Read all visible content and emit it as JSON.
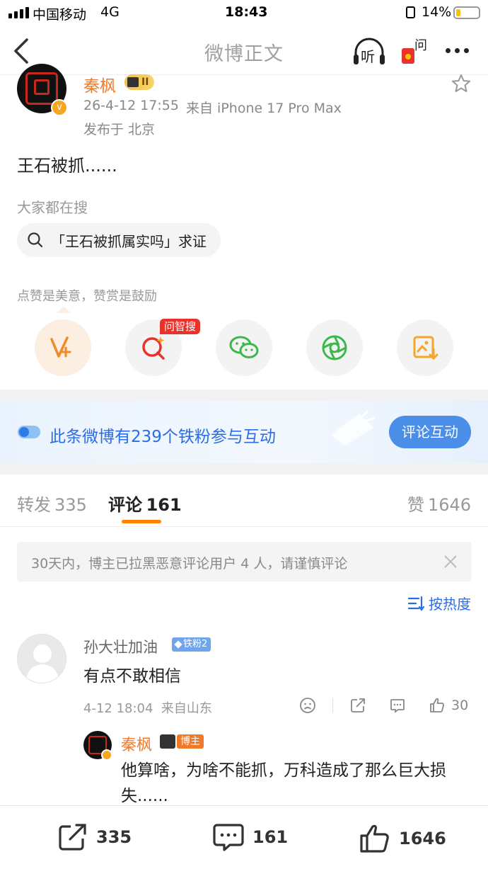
{
  "status": {
    "carrier": "中国移动",
    "network": "4G",
    "time": "18:43",
    "battery": "14%"
  },
  "nav": {
    "title": "微博正文",
    "listen_label": "听",
    "ask_label": "问"
  },
  "post": {
    "author": "秦枫",
    "badge_level": "II",
    "timestamp": "26-4-12 17:55",
    "source": "来自 iPhone 17 Pro Max",
    "location": "发布于 北京",
    "content": "王石被抓......"
  },
  "search": {
    "section_label": "大家都在搜",
    "pill_text": "「王石被抓属实吗」求证"
  },
  "reward": {
    "label": "点赞是美意，赞赏是鼓励",
    "ask_badge": "问智搜"
  },
  "fans_banner": {
    "text": "此条微博有239个铁粉参与互动",
    "button": "评论互动"
  },
  "tabs": {
    "repost": {
      "label": "转发",
      "count": "335"
    },
    "comment": {
      "label": "评论",
      "count": "161"
    },
    "like": {
      "label": "赞",
      "count": "1646"
    }
  },
  "notice": {
    "text": "30天内，博主已拉黑恶意评论用户 4 人，请谨慎评论"
  },
  "sort": {
    "label": "按热度"
  },
  "comment": {
    "user": "孙大壮加油",
    "fan_badge": "铁粉2",
    "text": "有点不敢相信",
    "meta": "4-12 18:04  来自山东",
    "likes": "30",
    "reply": {
      "user": "秦枫",
      "role_badge": "博主",
      "text": "他算啥，为啥不能抓，万科造成了那么巨大损失......"
    }
  },
  "bottom": {
    "repost": "335",
    "comment": "161",
    "like": "1646"
  },
  "colors": {
    "accent": "#ff8200",
    "link_blue": "#2b6de8",
    "button_blue": "#4a8ee8",
    "orange_name": "#f07a2a"
  }
}
